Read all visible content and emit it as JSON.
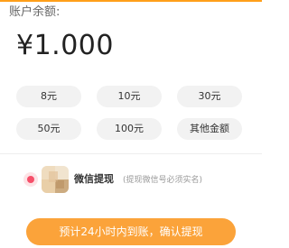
{
  "balance": {
    "label": "账户余额:",
    "amount": "¥1.000"
  },
  "amount_options": [
    "8元",
    "10元",
    "30元",
    "50元",
    "100元",
    "其他金额"
  ],
  "withdraw_method": {
    "title": "微信提现",
    "note": "(提现微信号必须实名)",
    "icon": "wechat-icon",
    "selected": true
  },
  "confirm_button": {
    "label": "预计24小时内到账，确认提现"
  },
  "colors": {
    "accent": "#fba33a",
    "radio": "#f6506a",
    "option_bg": "#f2f2f2"
  }
}
